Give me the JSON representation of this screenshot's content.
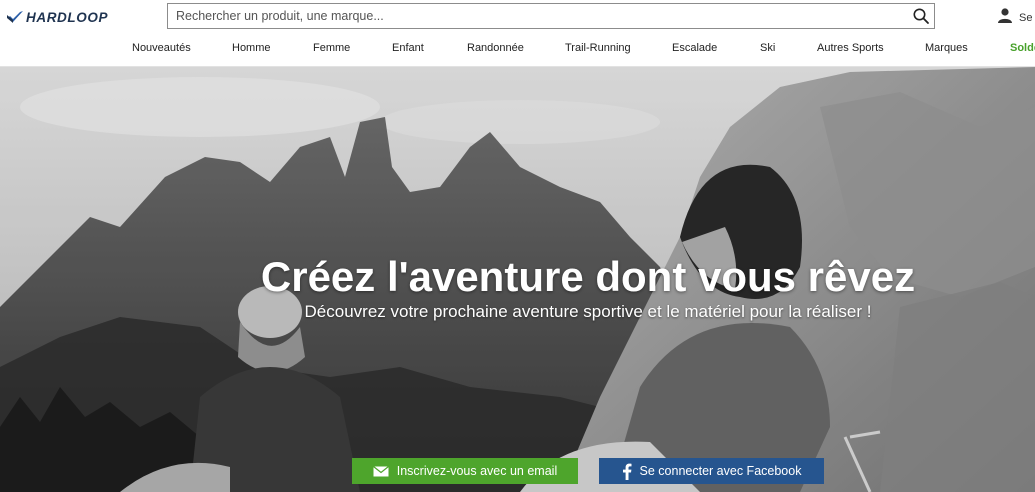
{
  "brand": {
    "name": "HARDLOOP"
  },
  "search": {
    "placeholder": "Rechercher un produit, une marque..."
  },
  "account": {
    "label": "Se"
  },
  "nav": [
    {
      "label": "Nouveautés"
    },
    {
      "label": "Homme"
    },
    {
      "label": "Femme"
    },
    {
      "label": "Enfant"
    },
    {
      "label": "Randonnée"
    },
    {
      "label": "Trail-Running"
    },
    {
      "label": "Escalade"
    },
    {
      "label": "Ski"
    },
    {
      "label": "Autres Sports"
    },
    {
      "label": "Marques"
    },
    {
      "label": "Solde"
    }
  ],
  "hero": {
    "title": "Créez l'aventure dont vous rêvez",
    "subtitle": "Découvrez votre prochaine aventure sportive et le matériel pour la réaliser !",
    "email_button": "Inscrivez-vous avec un email",
    "facebook_button": "Se connecter avec Facebook"
  },
  "colors": {
    "sale": "#48a12b",
    "email_button": "#4ea52c",
    "facebook_button": "#26558f",
    "logo": "#1f3350"
  },
  "icons": {
    "logo": "bird-logo-icon",
    "search": "search-icon",
    "account": "user-icon",
    "email": "envelope-icon",
    "facebook": "facebook-icon"
  }
}
